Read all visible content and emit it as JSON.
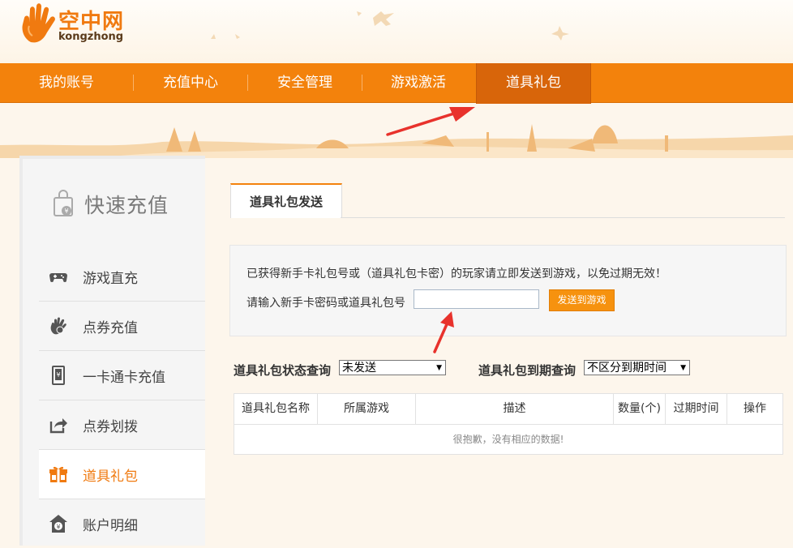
{
  "header": {
    "logo_cn": "空中网",
    "logo_en": "kongzhong"
  },
  "nav": {
    "items": [
      {
        "label": "我的账号"
      },
      {
        "label": "充值中心"
      },
      {
        "label": "安全管理"
      },
      {
        "label": "游戏激活"
      },
      {
        "label": "道具礼包"
      }
    ],
    "active": "道具礼包"
  },
  "sidebar": {
    "title": "快速充值",
    "items": [
      {
        "label": "游戏直充",
        "icon": "gamepad-icon"
      },
      {
        "label": "点券充值",
        "icon": "coupon-hand-icon"
      },
      {
        "label": "一卡通卡充值",
        "icon": "card-icon"
      },
      {
        "label": "点券划拨",
        "icon": "transfer-icon"
      },
      {
        "label": "道具礼包",
        "icon": "gift-icon"
      },
      {
        "label": "账户明细",
        "icon": "account-detail-icon"
      }
    ],
    "active": "道具礼包"
  },
  "main": {
    "tab_label": "道具礼包发送",
    "notice": "已获得新手卡礼包号或（道具礼包卡密）的玩家请立即发送到游戏，以免过期无效！",
    "input_label": "请输入新手卡密码或道具礼包号",
    "input_value": "",
    "send_button": "发送到游戏",
    "status_query_label": "道具礼包状态查询",
    "status_select_value": "未发送",
    "expiry_query_label": "道具礼包到期查询",
    "expiry_select_value": "不区分到期时间",
    "table": {
      "columns": [
        "道具礼包名称",
        "所属游戏",
        "描述",
        "数量(个)",
        "过期时间",
        "操作"
      ],
      "empty_message": "很抱歉，没有相应的数据!"
    }
  },
  "colors": {
    "brand_orange": "#f3820c",
    "nav_active": "#d8650a",
    "annotation_red": "#e8322c"
  }
}
